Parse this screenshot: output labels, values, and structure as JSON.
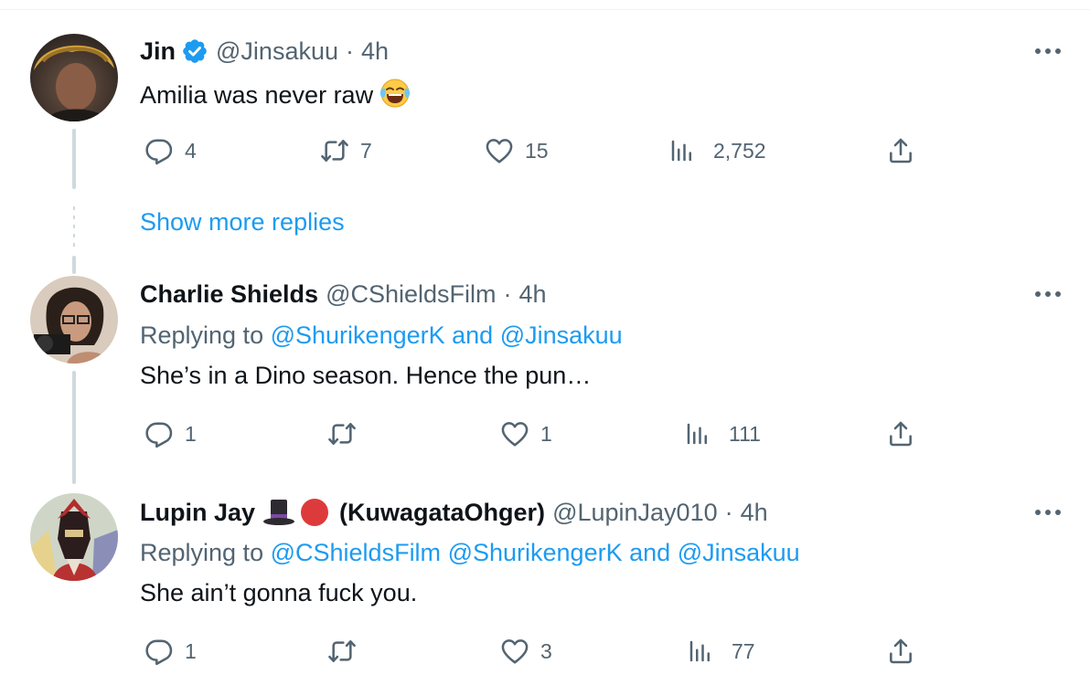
{
  "colors": {
    "text": "#0f1419",
    "secondary": "#536471",
    "accent": "#1d9bf0",
    "line": "#cfd9de"
  },
  "tweets": [
    {
      "name": "Jin",
      "verified": true,
      "handle": "@Jinsakuu",
      "sep": "·",
      "time": "4h",
      "text": "Amilia was never raw",
      "emoji": "face-with-tears-of-joy",
      "replies": "4",
      "retweets": "7",
      "likes": "15",
      "views": "2,752"
    },
    {
      "name": "Charlie Shields",
      "handle": "@CShieldsFilm",
      "sep": "·",
      "time": "4h",
      "replying_prefix": "Replying to",
      "mentions": [
        "@ShurikengerK",
        "@Jinsakuu"
      ],
      "and": "and",
      "text": "She’s in a Dino season. Hence the pun…",
      "replies": "1",
      "retweets": "",
      "likes": "1",
      "views": "111"
    },
    {
      "name": "Lupin Jay",
      "name_suffix": "(KuwagataOhger)",
      "name_emojis": [
        "top-hat",
        "red-circle"
      ],
      "handle": "@LupinJay010",
      "sep": "·",
      "time": "4h",
      "replying_prefix": "Replying to",
      "mentions": [
        "@CShieldsFilm",
        "@ShurikengerK",
        "@Jinsakuu"
      ],
      "and": "and",
      "text": "She ain’t gonna fuck you.",
      "replies": "1",
      "retweets": "",
      "likes": "3",
      "views": "77"
    }
  ],
  "show_more_replies": "Show more replies"
}
